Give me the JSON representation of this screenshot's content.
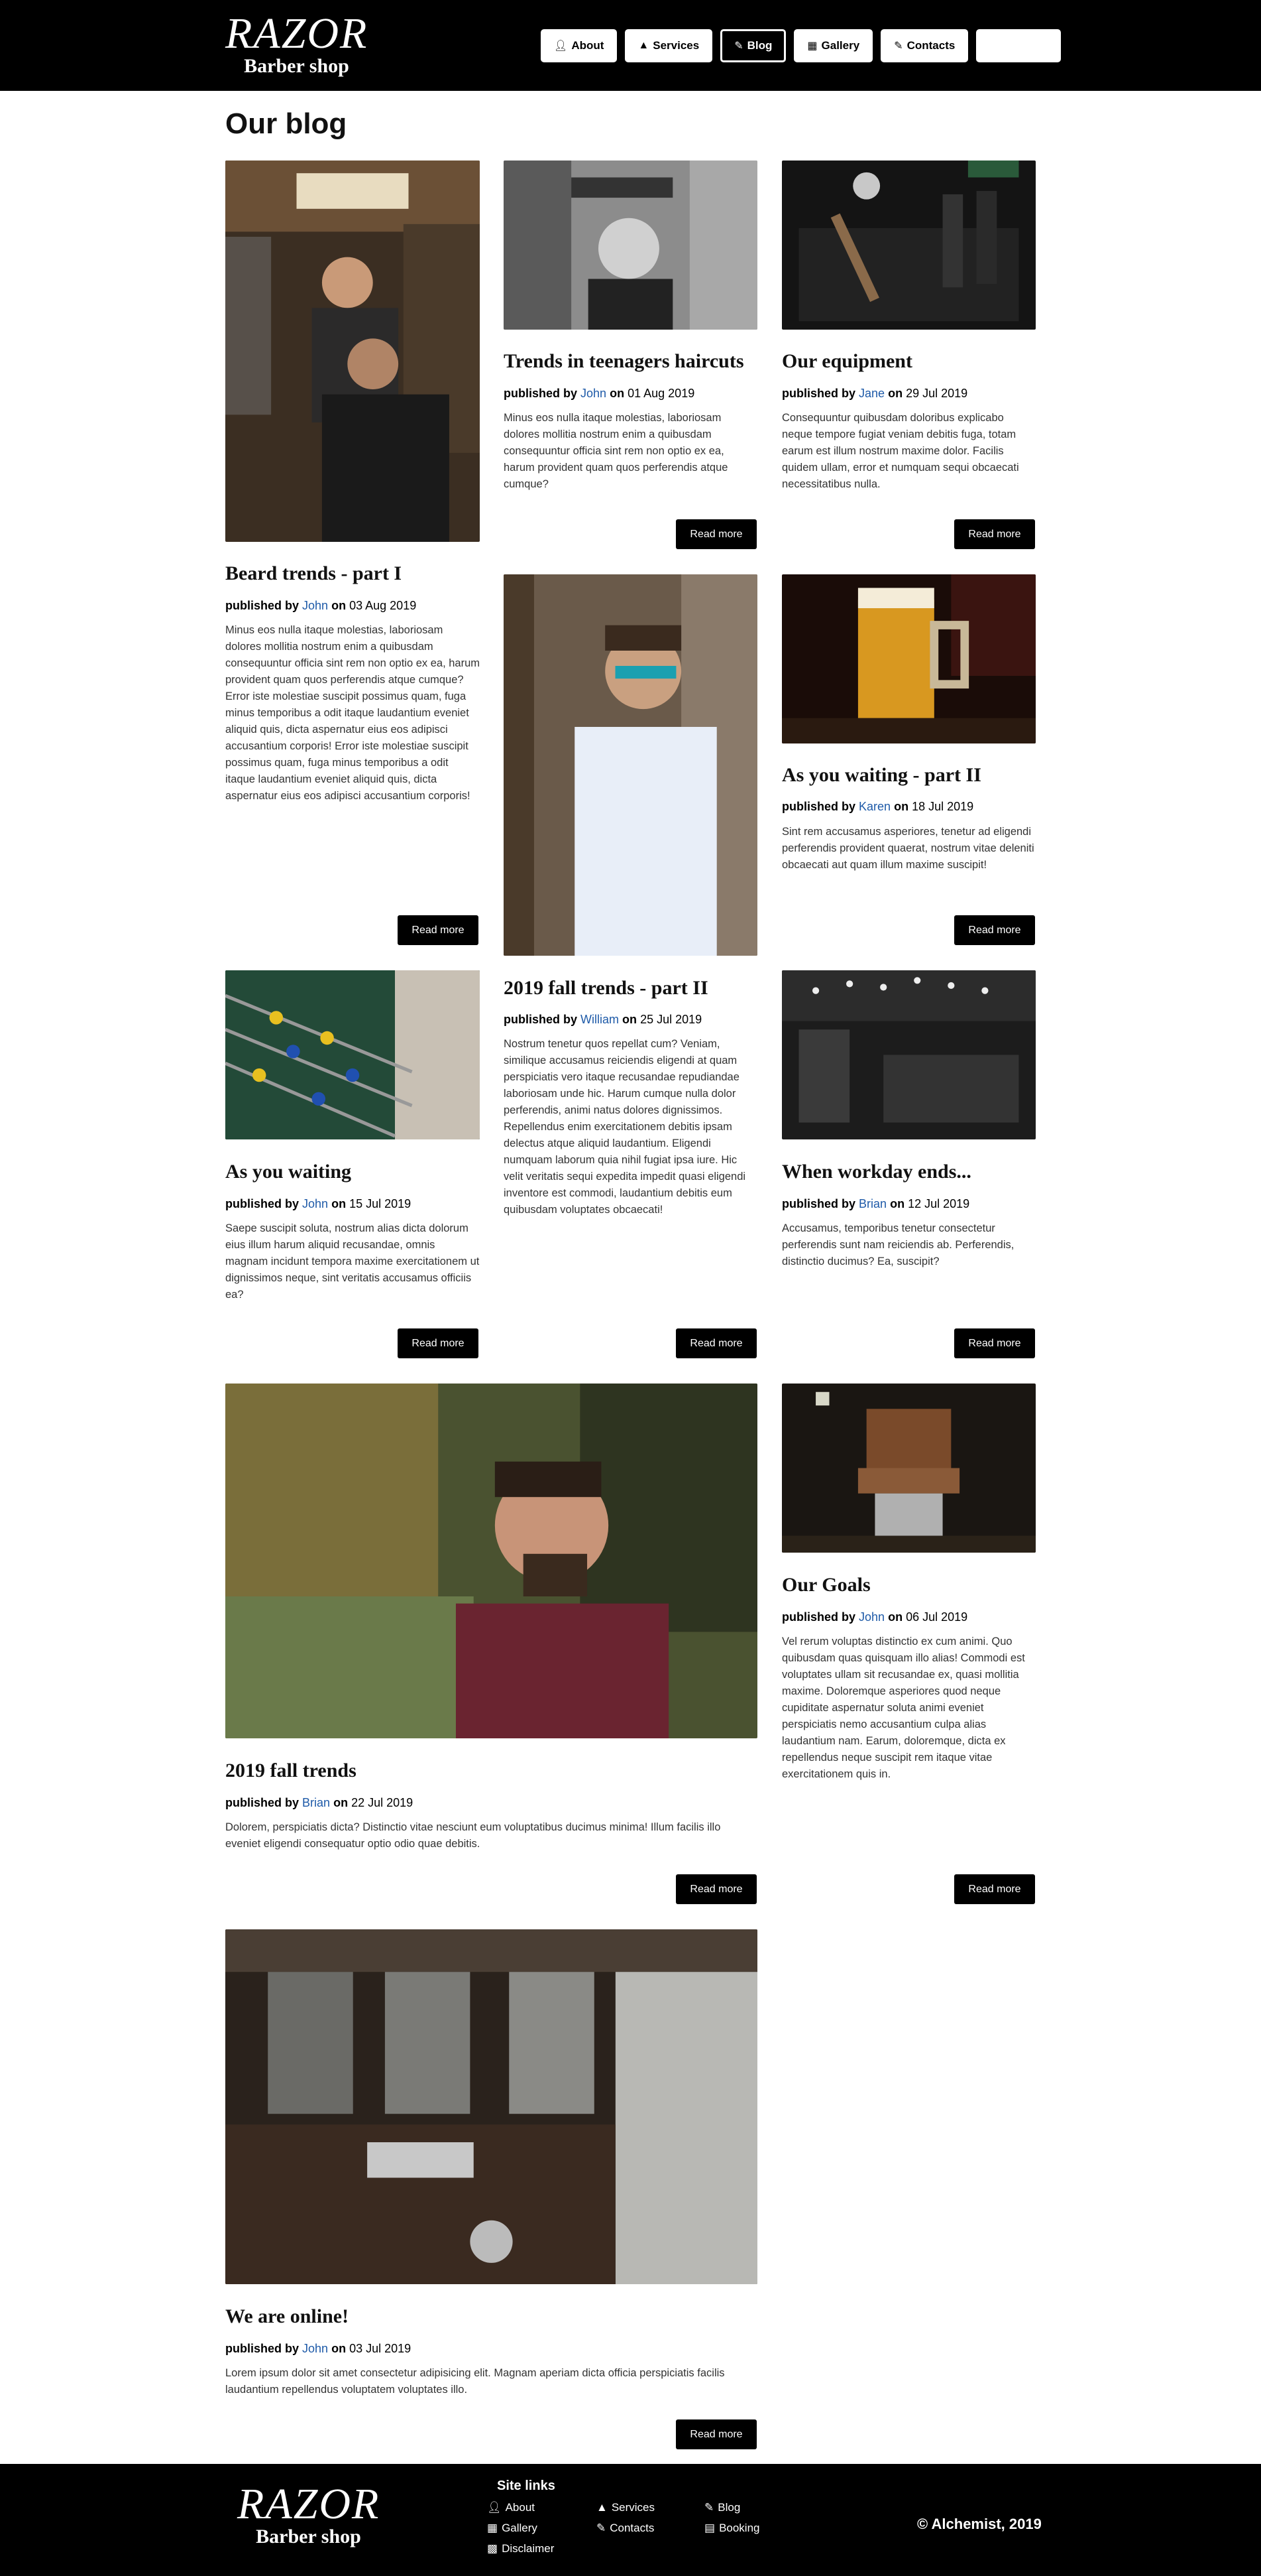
{
  "header": {
    "logo_main": "RAZOR",
    "logo_sub": "Barber shop",
    "nav": [
      {
        "label": "About",
        "icon": "user-icon"
      },
      {
        "label": "Services",
        "icon": "services-icon"
      },
      {
        "label": "Blog",
        "icon": "blog-icon"
      },
      {
        "label": "Gallery",
        "icon": "gallery-icon"
      },
      {
        "label": "Contacts",
        "icon": "contacts-icon"
      },
      {
        "label": "",
        "icon": "booking-button"
      }
    ]
  },
  "main": {
    "title": "Our blog",
    "read_more": "Read more",
    "published_by": "published by",
    "on": "on",
    "posts": [
      {
        "title": "Beard trends - part I",
        "author": "John",
        "date": "03 Aug 2019",
        "image": "barber-cutting-hair-photo",
        "excerpt": "Minus eos nulla itaque molestias, laboriosam dolores mollitia nostrum enim a quibusdam consequuntur officia sint rem non optio ex ea, harum provident quam quos perferendis atque cumque? Error iste molestiae suscipit possimus quam, fuga minus temporibus a odit itaque laudantium eveniet aliquid quis, dicta aspernatur eius eos adipisci accusantium corporis! Error iste molestiae suscipit possimus quam, fuga minus temporibus a odit itaque laudantium eveniet aliquid quis, dicta aspernatur eius eos adipisci accusantium corporis!"
      },
      {
        "title": "Trends in teenagers haircuts",
        "author": "John",
        "date": "01 Aug 2019",
        "image": "boy-haircut-bw-photo",
        "excerpt": "Minus eos nulla itaque molestias, laboriosam dolores mollitia nostrum enim a quibusdam consequuntur officia sint rem non optio ex ea, harum provident quam quos perferendis atque cumque?"
      },
      {
        "title": "Our equipment",
        "author": "Jane",
        "date": "29 Jul 2019",
        "image": "barber-tools-photo",
        "excerpt": "Consequuntur quibusdam doloribus explicabo neque tempore fugiat veniam debitis fuga, totam earum est illum nostrum maxime dolor. Facilis quidem ullam, error et numquam sequi obcaecati necessitatibus nulla."
      },
      {
        "title": "2019 fall trends - part II",
        "author": "William",
        "date": "25 Jul 2019",
        "image": "man-sunglasses-photo",
        "excerpt": "Nostrum tenetur quos repellat cum? Veniam, similique accusamus reiciendis eligendi at quam perspiciatis vero itaque recusandae repudiandae laboriosam unde hic. Harum cumque nulla dolor perferendis, animi natus dolores dignissimos. Repellendus enim exercitationem debitis ipsam delectus atque aliquid laudantium. Eligendi numquam laborum quia nihil fugiat ipsa iure. Hic velit veritatis sequi expedita impedit quasi eligendi inventore est commodi, laudantium debitis eum quibusdam voluptates obcaecati!"
      },
      {
        "title": "As you waiting - part II",
        "author": "Karen",
        "date": "18 Jul 2019",
        "image": "beer-mug-photo",
        "excerpt": "Sint rem accusamus asperiores, tenetur ad eligendi perferendis provident quaerat, nostrum vitae deleniti obcaecati aut quam illum maxime suscipit!"
      },
      {
        "title": "As you waiting",
        "author": "John",
        "date": "15 Jul 2019",
        "image": "foosball-table-photo",
        "excerpt": "Saepe suscipit soluta, nostrum alias dicta dolorum eius illum harum aliquid recusandae, omnis magnam incidunt tempora maxime exercitationem ut dignissimos neque, sint veritatis accusamus officiis ea?"
      },
      {
        "title": "When workday ends...",
        "author": "Brian",
        "date": "12 Jul 2019",
        "image": "shop-evening-photo",
        "excerpt": "Accusamus, temporibus tenetur consectetur perferendis sunt nam reiciendis ab. Perferendis, distinctio ducimus? Ea, suscipit?"
      },
      {
        "title": "2019 fall trends",
        "author": "Brian",
        "date": "22 Jul 2019",
        "image": "bearded-man-photo",
        "excerpt": "Dolorem, perspiciatis dicta? Distinctio vitae nesciunt eum voluptatibus ducimus minima! Illum facilis illo eveniet eligendi consequatur optio odio quae debitis."
      },
      {
        "title": "Our Goals",
        "author": "John",
        "date": "06 Jul 2019",
        "image": "barber-chair-photo",
        "excerpt": "Vel rerum voluptas distinctio ex cum animi. Quo quibusdam quas quisquam illo alias! Commodi est voluptates ullam sit recusandae ex, quasi mollitia maxime. Doloremque asperiores quod neque cupiditate aspernatur soluta animi eveniet perspiciatis nemo accusantium culpa alias laudantium nam. Earum, doloremque, dicta ex repellendus neque suscipit rem itaque vitae exercitationem quis in."
      },
      {
        "title": "We are online!",
        "author": "John",
        "date": "03 Jul 2019",
        "image": "barbershop-interior-photo",
        "excerpt": "Lorem ipsum dolor sit amet consectetur adipisicing elit. Magnam aperiam dicta officia perspiciatis facilis laudantium repellendus voluptatem voluptates illo."
      }
    ]
  },
  "footer": {
    "logo_main": "RAZOR",
    "logo_sub": "Barber shop",
    "links_title": "Site links",
    "links": [
      {
        "label": "About",
        "icon": "user-icon"
      },
      {
        "label": "Services",
        "icon": "services-icon"
      },
      {
        "label": "Blog",
        "icon": "blog-icon"
      },
      {
        "label": "Gallery",
        "icon": "gallery-icon"
      },
      {
        "label": "Contacts",
        "icon": "contacts-icon"
      },
      {
        "label": "Booking",
        "icon": "booking-icon"
      },
      {
        "label": "Disclaimer",
        "icon": "document-icon"
      }
    ],
    "copyright": "Alchemist, 2019",
    "copyright_icon": "copyright-icon"
  },
  "colors": {
    "header_bg": "#000000",
    "accent_link": "#1e5aa8",
    "button_bg": "#000000"
  }
}
